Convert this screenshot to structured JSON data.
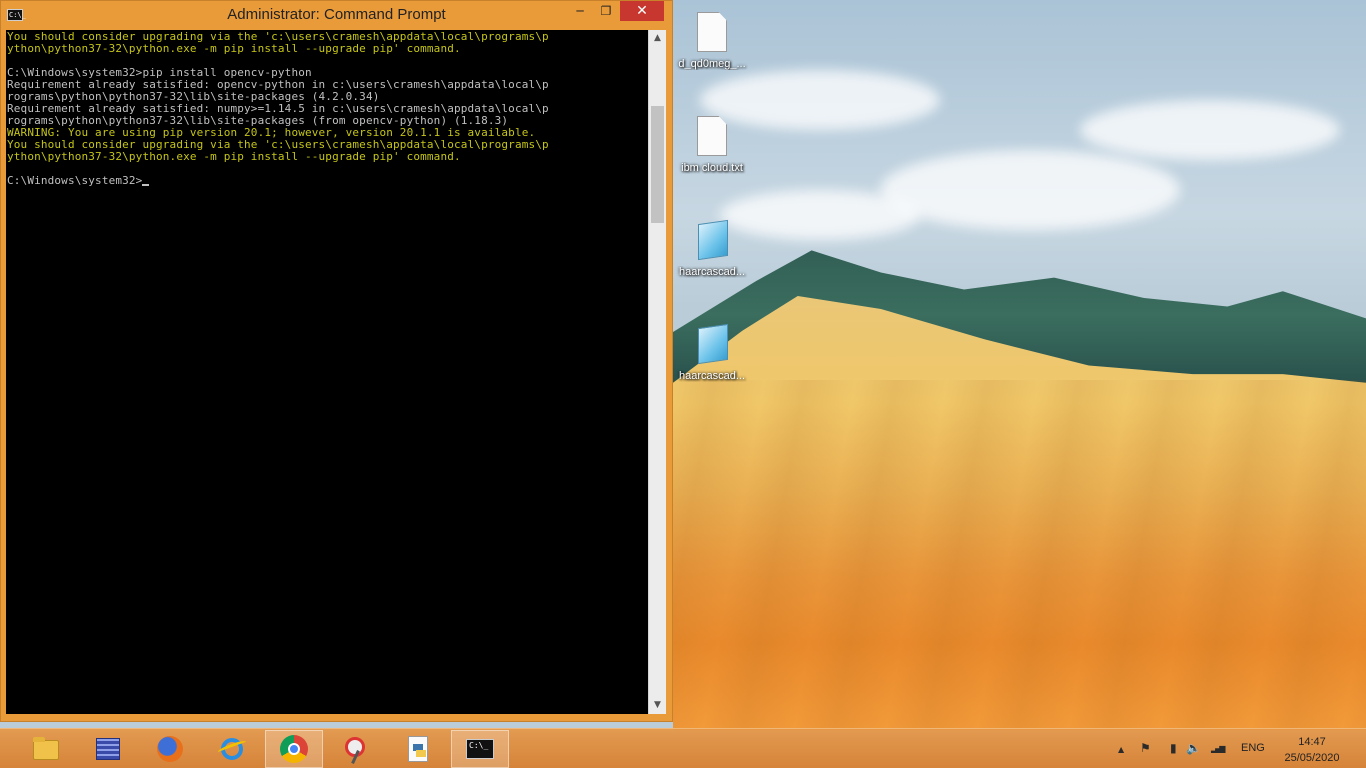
{
  "window": {
    "title": "Administrator: Command Prompt",
    "app_icon_text": "C:\\_",
    "minimize_glyph": "─",
    "maximize_glyph": "❐",
    "close_glyph": "✕"
  },
  "console": {
    "lines": [
      {
        "text": "You should consider upgrading via the 'c:\\users\\cramesh\\appdata\\local\\programs\\p",
        "style": "yellow"
      },
      {
        "text": "ython\\python37-32\\python.exe -m pip install --upgrade pip' command.",
        "style": "yellow"
      },
      {
        "text": "",
        "style": "gray"
      },
      {
        "text": "C:\\Windows\\system32>pip install opencv-python",
        "style": "gray"
      },
      {
        "text": "Requirement already satisfied: opencv-python in c:\\users\\cramesh\\appdata\\local\\p",
        "style": "gray"
      },
      {
        "text": "rograms\\python\\python37-32\\lib\\site-packages (4.2.0.34)",
        "style": "gray"
      },
      {
        "text": "Requirement already satisfied: numpy>=1.14.5 in c:\\users\\cramesh\\appdata\\local\\p",
        "style": "gray"
      },
      {
        "text": "rograms\\python\\python37-32\\lib\\site-packages (from opencv-python) (1.18.3)",
        "style": "gray"
      },
      {
        "text": "WARNING: You are using pip version 20.1; however, version 20.1.1 is available.",
        "style": "yellow"
      },
      {
        "text": "You should consider upgrading via the 'c:\\users\\cramesh\\appdata\\local\\programs\\p",
        "style": "yellow"
      },
      {
        "text": "ython\\python37-32\\python.exe -m pip install --upgrade pip' command.",
        "style": "yellow"
      },
      {
        "text": "",
        "style": "gray"
      },
      {
        "text": "C:\\Windows\\system32>",
        "style": "gray",
        "cursor": true
      }
    ],
    "scroll_position": 0.09,
    "scroll_visible_fraction": 0.18
  },
  "scrollbar": {
    "up_arrow": "▲",
    "down_arrow": "▼"
  },
  "desktop_icons": [
    {
      "label": "d_qd0meg_...",
      "icon": "text-document-icon"
    },
    {
      "label": "ibm cloud.txt",
      "icon": "text-document-icon"
    },
    {
      "label": "haarcascad...",
      "icon": "notepad-icon"
    },
    {
      "label": "haarcascad...",
      "icon": "notepad-icon"
    }
  ],
  "taskbar": {
    "pinned": [
      {
        "name": "file-explorer",
        "icon": "folder-icon",
        "active": true
      },
      {
        "name": "network-app",
        "icon": "network-icon",
        "active": false
      },
      {
        "name": "firefox",
        "icon": "firefox-icon",
        "active": false
      },
      {
        "name": "internet-explorer",
        "icon": "ie-icon",
        "active": false
      },
      {
        "name": "chrome",
        "icon": "chrome-icon",
        "active": true
      },
      {
        "name": "snipping-tool",
        "icon": "snipping-tool-icon",
        "active": false
      },
      {
        "name": "python-file",
        "icon": "python-icon",
        "active": false
      },
      {
        "name": "command-prompt",
        "icon": "cmd-icon",
        "active": true
      }
    ],
    "cmd_icon_text": "C:\\_",
    "tray": {
      "show_hidden_glyph": "▲",
      "flag_glyph": "⚑",
      "battery_glyph": "▮",
      "volume_glyph": "🔈",
      "signal_glyph": "▂▄▆",
      "language": "ENG",
      "time": "14:47",
      "date": "25/05/2020"
    }
  },
  "colors": {
    "accent": "#e99b3a",
    "console_bg": "#000000",
    "console_text": "#c0c0c0",
    "console_warning": "#c5c517",
    "close_button": "#c7372f"
  }
}
